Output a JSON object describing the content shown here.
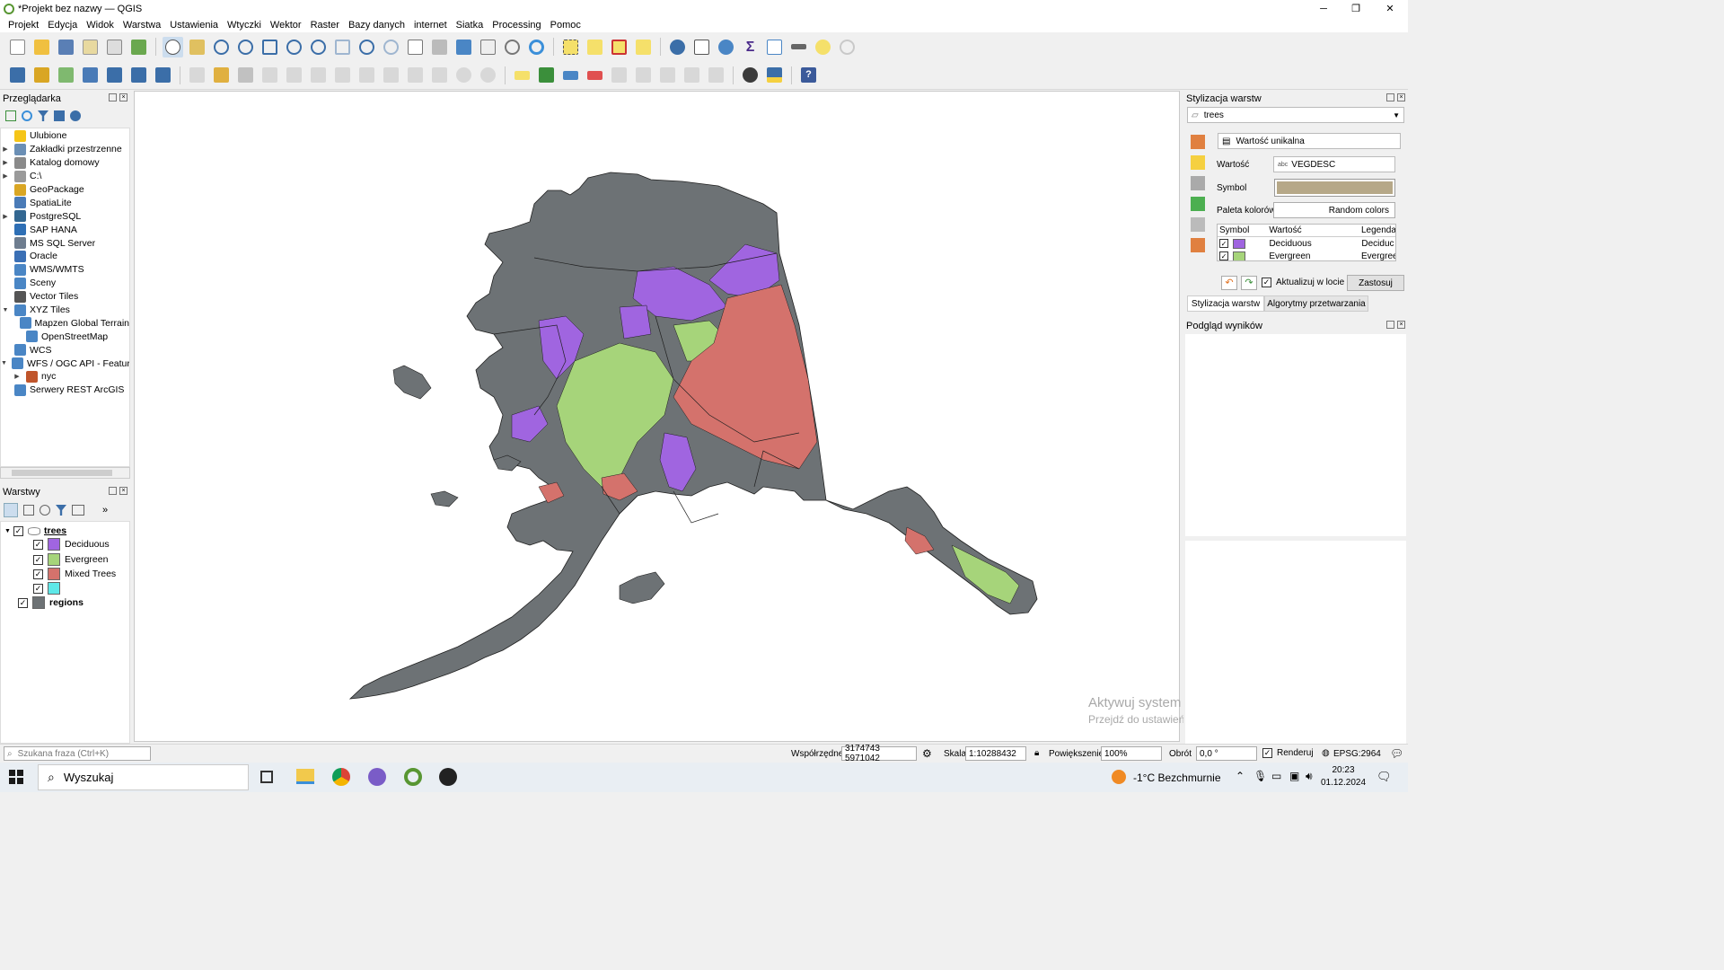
{
  "window": {
    "title": "*Projekt bez nazwy — QGIS",
    "controls": [
      "─",
      "❐",
      "✕"
    ]
  },
  "menu": [
    "Projekt",
    "Edycja",
    "Widok",
    "Warstwa",
    "Ustawienia",
    "Wtyczki",
    "Wektor",
    "Raster",
    "Bazy danych",
    "internet",
    "Siatka",
    "Processing",
    "Pomoc"
  ],
  "browser": {
    "title": "Przeglądarka",
    "items": [
      {
        "label": "Ulubione",
        "icon": "star-icon",
        "color": "#f5c518",
        "arrow": "",
        "sub": false
      },
      {
        "label": "Zakładki przestrzenne",
        "icon": "bookmark-icon",
        "color": "#6b8fb5",
        "arrow": "▶",
        "sub": false
      },
      {
        "label": "Katalog domowy",
        "icon": "home-folder-icon",
        "color": "#8a8a8a",
        "arrow": "▶",
        "sub": false
      },
      {
        "label": "C:\\",
        "icon": "drive-icon",
        "color": "#9a9a9a",
        "arrow": "▶",
        "sub": false
      },
      {
        "label": "GeoPackage",
        "icon": "geopackage-icon",
        "color": "#d9a624",
        "arrow": "",
        "sub": false
      },
      {
        "label": "SpatiaLite",
        "icon": "spatialite-icon",
        "color": "#4a7bb7",
        "arrow": "",
        "sub": false
      },
      {
        "label": "PostgreSQL",
        "icon": "postgresql-icon",
        "color": "#336791",
        "arrow": "▶",
        "sub": false
      },
      {
        "label": "SAP HANA",
        "icon": "sap-hana-icon",
        "color": "#2e6fb5",
        "arrow": "",
        "sub": false
      },
      {
        "label": "MS SQL Server",
        "icon": "mssql-icon",
        "color": "#6e7d8f",
        "arrow": "",
        "sub": false
      },
      {
        "label": "Oracle",
        "icon": "oracle-icon",
        "color": "#3a6fb5",
        "arrow": "",
        "sub": false
      },
      {
        "label": "WMS/WMTS",
        "icon": "wms-globe-icon",
        "color": "#4a86c5",
        "arrow": "",
        "sub": false
      },
      {
        "label": "Sceny",
        "icon": "scene-icon",
        "color": "#4a86c5",
        "arrow": "",
        "sub": false
      },
      {
        "label": "Vector Tiles",
        "icon": "vector-tiles-icon",
        "color": "#555555",
        "arrow": "",
        "sub": false
      },
      {
        "label": "XYZ Tiles",
        "icon": "xyz-tiles-icon",
        "color": "#4a86c5",
        "arrow": "▼",
        "sub": false
      },
      {
        "label": "Mapzen Global Terrain",
        "icon": "tile-grid-icon",
        "color": "#4a86c5",
        "arrow": "",
        "sub": true
      },
      {
        "label": "OpenStreetMap",
        "icon": "tile-grid-icon",
        "color": "#4a86c5",
        "arrow": "",
        "sub": true
      },
      {
        "label": "WCS",
        "icon": "wcs-globe-icon",
        "color": "#4a86c5",
        "arrow": "",
        "sub": false
      },
      {
        "label": "WFS / OGC API - Features",
        "icon": "wfs-globe-icon",
        "color": "#4a86c5",
        "arrow": "▼",
        "sub": false
      },
      {
        "label": "nyc",
        "icon": "connection-icon",
        "color": "#c0552b",
        "arrow": "▶",
        "sub": true
      },
      {
        "label": "Serwery REST ArcGIS",
        "icon": "arcgis-icon",
        "color": "#4a86c5",
        "arrow": "",
        "sub": false
      }
    ]
  },
  "layers": {
    "title": "Warstwy",
    "group": "trees",
    "classes": [
      {
        "label": "Deciduous",
        "color": "#a065e0"
      },
      {
        "label": "Evergreen",
        "color": "#a6d47a"
      },
      {
        "label": "Mixed Trees",
        "color": "#d4726c"
      },
      {
        "label": "",
        "color": "#5ee8e8"
      }
    ],
    "regions": {
      "label": "regions",
      "color": "#6d7275"
    }
  },
  "styling": {
    "title": "Stylizacja warstw",
    "layer": "trees",
    "renderer": "Wartość unikalna",
    "value_label": "Wartość",
    "value_field": "VEGDESC",
    "value_prefix": "abc",
    "symbol_label": "Symbol",
    "symbol_color": "#b6a888",
    "palette_label": "Paleta kolorów",
    "palette_value": "Random colors",
    "table_headers": [
      "Symbol",
      "Wartość",
      "Legenda"
    ],
    "rows": [
      {
        "value": "Deciduous",
        "legend": "Deciduc",
        "color": "#a065e0"
      },
      {
        "value": "Evergreen",
        "legend": "Evergree",
        "color": "#a6d47a"
      }
    ],
    "live_update": "Aktualizuj w locie",
    "apply": "Zastosuj",
    "tabs": [
      "Stylizacja warstw",
      "Algorytmy przetwarzania"
    ]
  },
  "results": {
    "title": "Podgląd wyników"
  },
  "watermark": {
    "line1": "Aktywuj system Windows",
    "line2": "Przejdź do ustawień, aby aktywować system Windows."
  },
  "status": {
    "search_placeholder": "Szukana fraza (Ctrl+K)",
    "coord_label": "Współrzędne",
    "coord_value": "3174743  5971042",
    "scale_label": "Skala",
    "scale_value": "1:10288432",
    "zoom_label": "Powiększenie",
    "zoom_value": "100%",
    "rotation_label": "Obrót",
    "rotation_value": "0,0 °",
    "render_label": "Renderuj",
    "crs": "EPSG:2964"
  },
  "taskbar": {
    "search": "Wyszukaj",
    "weather": "-1°C  Bezchmurnie",
    "time": "20:23",
    "date": "01.12.2024"
  },
  "colors": {
    "deciduous": "#a065e0",
    "evergreen": "#a6d47a",
    "mixed": "#d4726c",
    "regions": "#6d7275",
    "outline": "#1f1f1f"
  }
}
